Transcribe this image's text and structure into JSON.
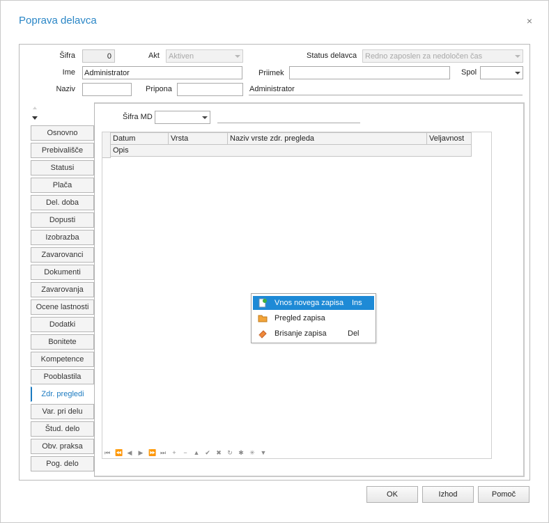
{
  "dialog": {
    "title": "Poprava delavca",
    "close_symbol": "×"
  },
  "header": {
    "sifra_label": "Šifra",
    "sifra_value": "0",
    "akt_label": "Akt",
    "akt_value": "Aktiven",
    "status_label": "Status delavca",
    "status_value": "Redno zaposlen za nedoločen čas",
    "ime_label": "Ime",
    "ime_value": "Administrator",
    "priimek_label": "Priimek",
    "priimek_value": "",
    "spol_label": "Spol",
    "spol_value": "",
    "naziv_label": "Naziv",
    "naziv_value": "",
    "pripona_label": "Pripona",
    "pripona_value": "",
    "full_name": "Administrator"
  },
  "tabs": [
    {
      "label": "Osnovno"
    },
    {
      "label": "Prebivališče"
    },
    {
      "label": "Statusi"
    },
    {
      "label": "Plača"
    },
    {
      "label": "Del. doba"
    },
    {
      "label": "Dopusti"
    },
    {
      "label": "Izobrazba"
    },
    {
      "label": "Zavarovanci"
    },
    {
      "label": "Dokumenti"
    },
    {
      "label": "Zavarovanja"
    },
    {
      "label": "Ocene lastnosti"
    },
    {
      "label": "Dodatki"
    },
    {
      "label": "Bonitete"
    },
    {
      "label": "Kompetence"
    },
    {
      "label": "Pooblastila"
    },
    {
      "label": "Zdr. pregledi",
      "active": true
    },
    {
      "label": "Var. pri delu"
    },
    {
      "label": "Štud. delo"
    },
    {
      "label": "Obv. praksa"
    },
    {
      "label": "Pog. delo"
    }
  ],
  "panel": {
    "sifra_md_label": "Šifra MD",
    "sifra_md_value": "",
    "grid": {
      "columns": [
        "Datum",
        "Vrsta",
        "Naziv vrste zdr. pregleda",
        "Veljavnost"
      ],
      "subrow": "Opis"
    },
    "navigator": [
      "⏮",
      "⏪",
      "◀",
      "▶",
      "⏩",
      "⏭",
      "+",
      "−",
      "▲",
      "✔",
      "✖",
      "↻",
      "✱",
      "✳",
      "▼"
    ]
  },
  "context_menu": [
    {
      "label": "Vnos novega zapisa",
      "shortcut": "Ins",
      "icon": "new-record-icon",
      "highlighted": true
    },
    {
      "label": "Pregled zapisa",
      "shortcut": "",
      "icon": "folder-icon"
    },
    {
      "label": "Brisanje zapisa",
      "shortcut": "Del",
      "icon": "eraser-icon"
    }
  ],
  "buttons": {
    "ok": "OK",
    "exit": "Izhod",
    "help": "Pomoč"
  },
  "colors": {
    "accent": "#1b7ac0",
    "title": "#2a86c6",
    "menu_highlight": "#1e8ad6"
  }
}
